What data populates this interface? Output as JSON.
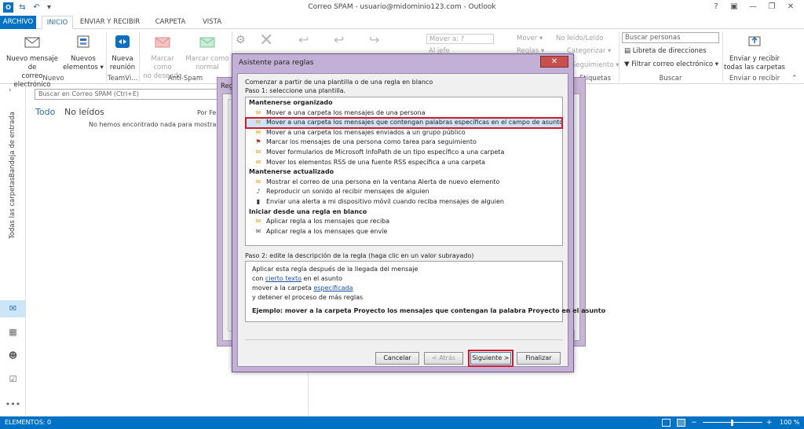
{
  "window": {
    "title": "Correo SPAM - usuario@midominio123.com - Outlook",
    "controls": [
      "?",
      "▣",
      "—",
      "❐",
      "✕"
    ]
  },
  "tabs": [
    "ARCHIVO",
    "INICIO",
    "ENVIAR Y RECIBIR",
    "CARPETA",
    "VISTA"
  ],
  "ribbon": {
    "nuevo": {
      "mail": [
        "Nuevo mensaje de",
        "correo electrónico"
      ],
      "items": [
        "Nuevos",
        "elementos ▾"
      ],
      "label": "Nuevo"
    },
    "teamviewer": {
      "btn": [
        "Nueva",
        "reunión"
      ],
      "label": "TeamVi..."
    },
    "antispam": {
      "no_deseado": [
        "Marcar como",
        "no deseado"
      ],
      "normal": [
        "Marcar como",
        "normal"
      ],
      "label": "Anti-Spam"
    },
    "mover": {
      "mover_a": "Mover a: ?",
      "al_jefe": "Al jefe",
      "mover": "Mover ▾",
      "reglas": "Reglas ▾"
    },
    "etiquetas": {
      "no_leido": "No leído/Leído",
      "categorizar": "Categorizar ▾",
      "seguimiento": "Seguimiento ▾",
      "label": "Etiquetas"
    },
    "buscar": {
      "placeholder": "Buscar personas",
      "libreta": "Libreta de direcciones",
      "filtrar": "Filtrar correo electrónico ▾",
      "label": "Buscar"
    },
    "enviar": {
      "btn": [
        "Enviar y recibir",
        "todas las carpetas"
      ],
      "label": "Enviar o recibir"
    }
  },
  "leftnav": {
    "bandeja": "Bandeja de entrada",
    "todas": "Todas las carpetas"
  },
  "msglist": {
    "search_placeholder": "Buscar en Correo SPAM (Ctrl+E)",
    "filter_todo": "Todo",
    "filter_no_leidos": "No leídos",
    "sort": "Por Fe",
    "empty": "No hemos encontrado nada para mostrar"
  },
  "bgdialog": {
    "title": "Regl"
  },
  "wizard": {
    "title": "Asistente para reglas",
    "intro": "Comenzar a partir de una plantilla o de una regla en blanco",
    "step1": "Paso 1: seleccione una plantilla.",
    "groups": [
      {
        "heading": "Mantenerse organizado",
        "items": [
          {
            "icon": "✉",
            "label": "Mover a una carpeta los mensajes de una persona"
          },
          {
            "icon": "✉",
            "label": "Mover a una carpeta los mensajes que contengan palabras específicas en el campo de asunto",
            "selected": true
          },
          {
            "icon": "✉",
            "label": "Mover a una carpeta los mensajes enviados a un grupo público"
          },
          {
            "icon": "⚑",
            "label": "Marcar los mensajes de una persona como tarea para seguimiento"
          },
          {
            "icon": "✉",
            "label": "Mover formularios de Microsoft InfoPath de un tipo específico a una carpeta"
          },
          {
            "icon": "✉",
            "label": "Mover los elementos RSS de una fuente RSS específica a una carpeta"
          }
        ]
      },
      {
        "heading": "Mantenerse actualizado",
        "items": [
          {
            "icon": "✉",
            "label": "Mostrar el correo de una persona en la ventana Alerta de nuevo elemento"
          },
          {
            "icon": "♪",
            "label": "Reproducir un sonido al recibir mensajes de alguien"
          },
          {
            "icon": "▮",
            "label": "Enviar una alerta a mi dispositivo móvil cuando reciba mensajes de alguien"
          }
        ]
      },
      {
        "heading": "Iniciar desde una regla en blanco",
        "items": [
          {
            "icon": "✉",
            "label": "Aplicar regla a los mensajes que reciba"
          },
          {
            "icon": "✉",
            "label": "Aplicar regla a los mensajes que envíe"
          }
        ]
      }
    ],
    "step2": "Paso 2: edite la descripción de la regla (haga clic en un valor subrayado)",
    "desc": {
      "line1": "Aplicar esta regla después de la llegada del mensaje",
      "line2_pre": "con ",
      "line2_link": "cierto texto",
      "line2_post": " en el asunto",
      "line3_pre": "mover a la carpeta ",
      "line3_link": "especificada",
      "line4": " y detener el proceso de más reglas",
      "example": "Ejemplo: mover a la carpeta Proyecto los mensajes que contengan la palabra Proyecto en el asunto"
    },
    "buttons": {
      "cancel": "Cancelar",
      "back": "< Atrás",
      "next": "Siguiente >",
      "finish": "Finalizar"
    }
  },
  "status": {
    "items": "ELEMENTOS: 0",
    "zoom": "100 %"
  },
  "colors": {
    "accent": "#0072c6",
    "highlight": "#d6182c",
    "dialog_frame": "#c3b0d6"
  }
}
